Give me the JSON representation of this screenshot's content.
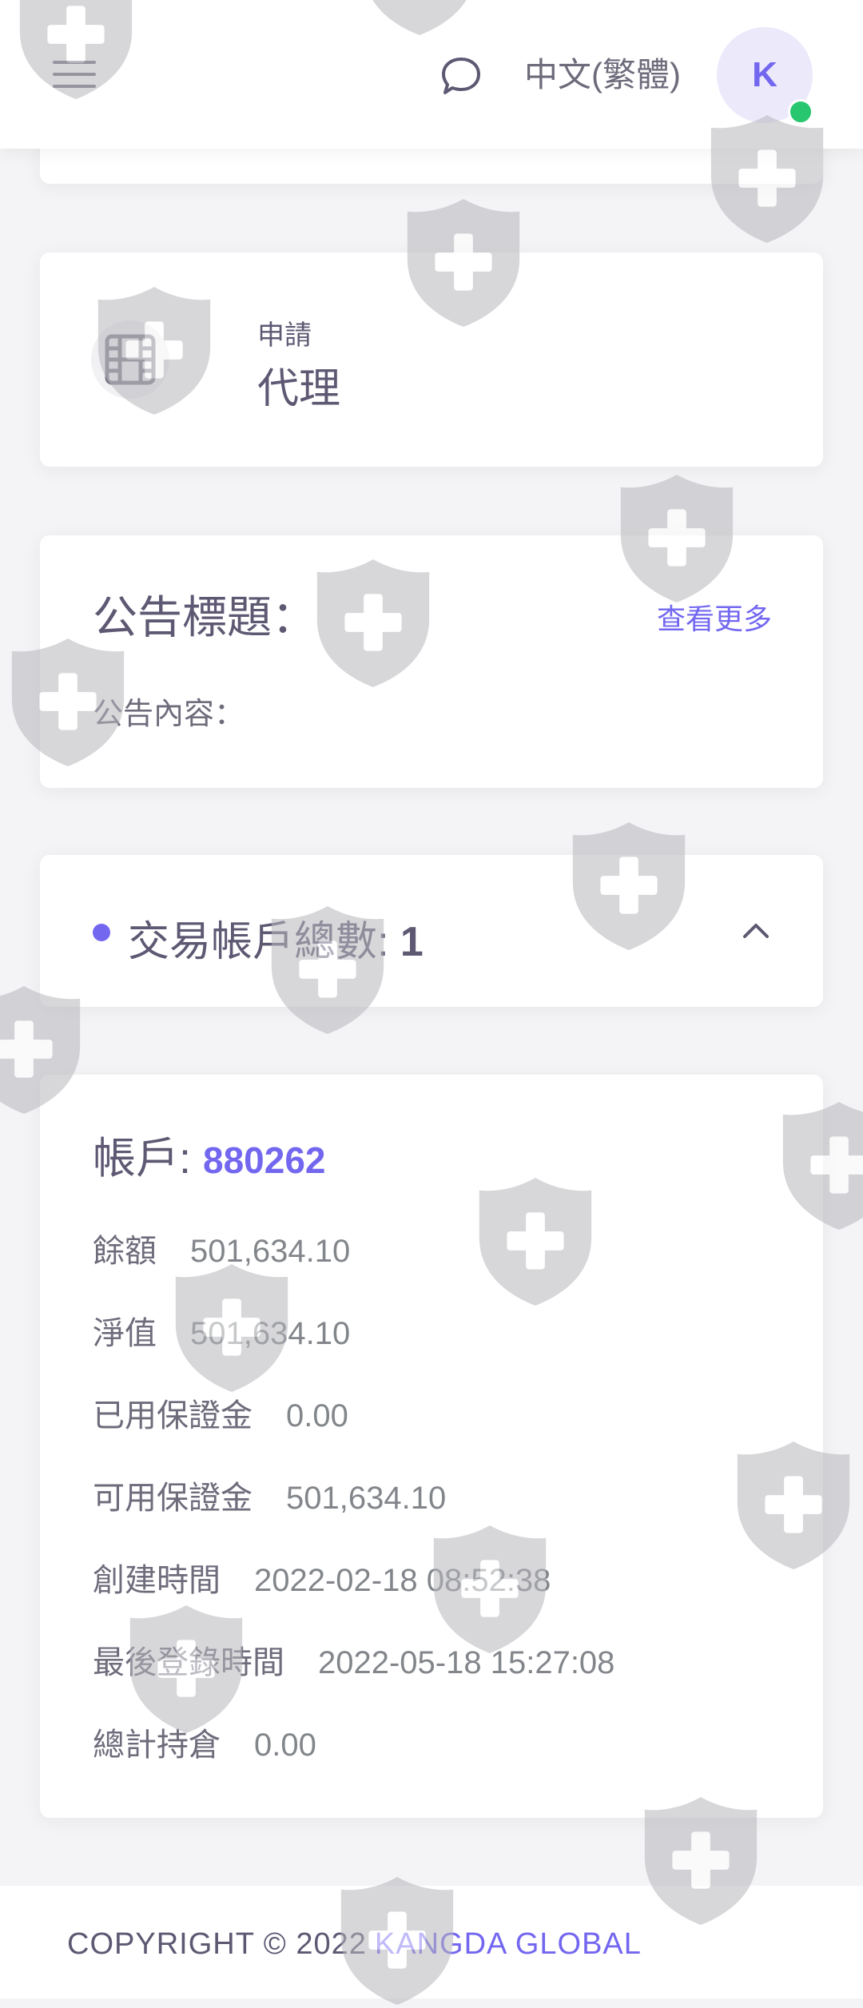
{
  "header": {
    "language": "中文(繁體)",
    "avatar_initial": "K",
    "icons": [
      "menu-icon",
      "chat-icon"
    ]
  },
  "apply": {
    "label": "申請",
    "title": "代理",
    "icon": "film-icon"
  },
  "notice": {
    "title": "公告標題：",
    "more": "查看更多",
    "content_label": "公告內容："
  },
  "accounts": {
    "title": "交易帳戶總數: ",
    "count": "1",
    "icon": "chevron-up-icon"
  },
  "account_detail": {
    "label": "帳戶: ",
    "number": "880262",
    "rows": [
      {
        "label": "餘額",
        "value": "501,634.10"
      },
      {
        "label": "淨值",
        "value": "501,634.10"
      },
      {
        "label": "已用保證金",
        "value": "0.00"
      },
      {
        "label": "可用保證金",
        "value": "501,634.10"
      },
      {
        "label": "創建時間",
        "value": "2022-02-18 08:52:38"
      },
      {
        "label": "最後登錄時間",
        "value": "2022-05-18 15:27:08"
      },
      {
        "label": "總計持倉",
        "value": "0.00"
      }
    ]
  },
  "footer": {
    "copyright": "COPYRIGHT © 2022",
    "brand": "KANGDA GLOBAL"
  },
  "colors": {
    "accent": "#7367f0",
    "online": "#28c76f",
    "background": "#f4f4f6"
  }
}
